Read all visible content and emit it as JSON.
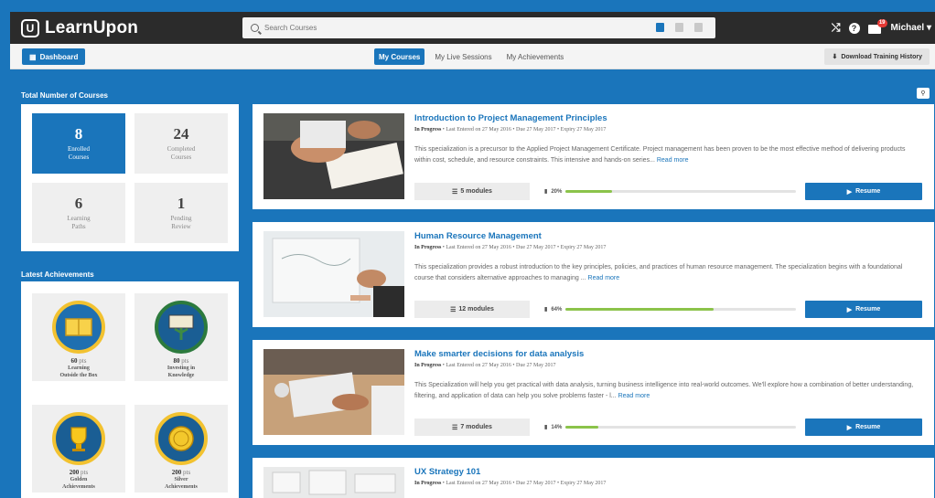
{
  "app": {
    "logo_text": "LearnUpon",
    "logo_mark": "U",
    "search_placeholder": "Search Courses",
    "user_name": "Michael",
    "notification_count": "19",
    "accent": "#1a75bb",
    "progress_color": "#8bc34a"
  },
  "subnav": {
    "dashboard_label": "Dashboard",
    "tabs": [
      {
        "label": "My Courses",
        "active": true
      },
      {
        "label": "My Live Sessions",
        "active": false
      },
      {
        "label": "My Achievements",
        "active": false
      }
    ],
    "download_label": "Download Training History"
  },
  "stats": {
    "title": "Total Number of Courses",
    "items": [
      {
        "num": "8",
        "label": "Enrolled\nCourses"
      },
      {
        "num": "24",
        "label": "Completed\nCourses"
      },
      {
        "num": "6",
        "label": "Learning\nPaths"
      },
      {
        "num": "1",
        "label": "Pending\nReview"
      }
    ]
  },
  "achievements": {
    "title": "Latest Achievements",
    "items": [
      {
        "pts": "60",
        "unit": "pts",
        "name": "Learning\nOutside the Box",
        "icon": "book-badge-icon"
      },
      {
        "pts": "80",
        "unit": "pts",
        "name": "Investing in\nKnowledge",
        "icon": "book-tree-badge-icon"
      },
      {
        "pts": "200",
        "unit": "pts",
        "name": "Golden\nAchievements",
        "icon": "gold-trophy-badge-icon"
      },
      {
        "pts": "200",
        "unit": "pts",
        "name": "Silver\nAchievements",
        "icon": "silver-coin-badge-icon"
      }
    ]
  },
  "courses": [
    {
      "title": "Introduction to Project Management Principles",
      "status": "In Progress",
      "enrolled": "Last Entered on 27 May 2016",
      "due": "Due 27 May 2017",
      "expiry": "Expiry 27 May 2017",
      "desc": "This specialization is a precursor to the Applied Project Management Certificate. Project management has been proven to be the most effective method of delivering products within cost, schedule, and resource constraints. This intensive and hands-on series...",
      "read_more": "Read more",
      "modules": "5 modules",
      "progress_label": "20%",
      "progress": 0.2,
      "resume": "Resume"
    },
    {
      "title": "Human Resource Management",
      "status": "In Progress",
      "enrolled": "Last Entered on 27 May 2016",
      "due": "Due 27 May 2017",
      "expiry": "Expiry 27 May 2017",
      "desc": "This specialization provides a robust introduction to the key principles, policies, and practices of human resource management. The specialization begins with a foundational course that considers alternative approaches to managing ...",
      "read_more": "Read more",
      "modules": "12 modules",
      "progress_label": "64%",
      "progress": 0.64,
      "resume": "Resume"
    },
    {
      "title": "Make smarter decisions for data analysis",
      "status": "In Progress",
      "enrolled": "Last Entered on 27 May 2016",
      "due": "Due 27 May 2017",
      "expiry": "",
      "desc": "This Specialization will help you get practical with data analysis, turning business intelligence into real-world outcomes. We'll explore how a combination of better understanding, filtering, and application of data can help you solve problems faster - l...",
      "read_more": "Read more",
      "modules": "7 modules",
      "progress_label": "14%",
      "progress": 0.14,
      "resume": "Resume"
    },
    {
      "title": "UX Strategy 101",
      "status": "In Progress",
      "enrolled": "Last Entered on 27 May 2016",
      "due": "Due 27 May 2017",
      "expiry": "Expiry 27 May 2017",
      "desc": "",
      "read_more": "",
      "modules": "",
      "progress_label": "",
      "progress": 0,
      "resume": ""
    }
  ]
}
